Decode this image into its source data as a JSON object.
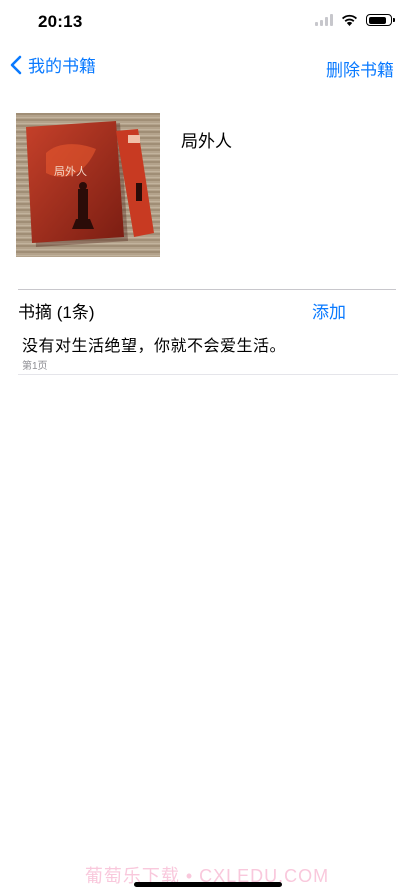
{
  "status_bar": {
    "time": "20:13",
    "battery_level": 0.85
  },
  "nav": {
    "back_label": "我的书籍",
    "action_label": "删除书籍"
  },
  "book": {
    "title": "局外人",
    "cover_title": "局外人"
  },
  "excerpts": {
    "header": "书摘 (1条)",
    "add_label": "添加",
    "items": [
      {
        "text": "没有对生活绝望，你就不会爱生活。",
        "page": "第1页"
      }
    ]
  },
  "watermark": "葡萄乐下载 • CXLEDU.COM",
  "colors": {
    "accent": "#0a7aff",
    "divider": "#c8c7cc",
    "secondary_text": "#8e8e93"
  }
}
